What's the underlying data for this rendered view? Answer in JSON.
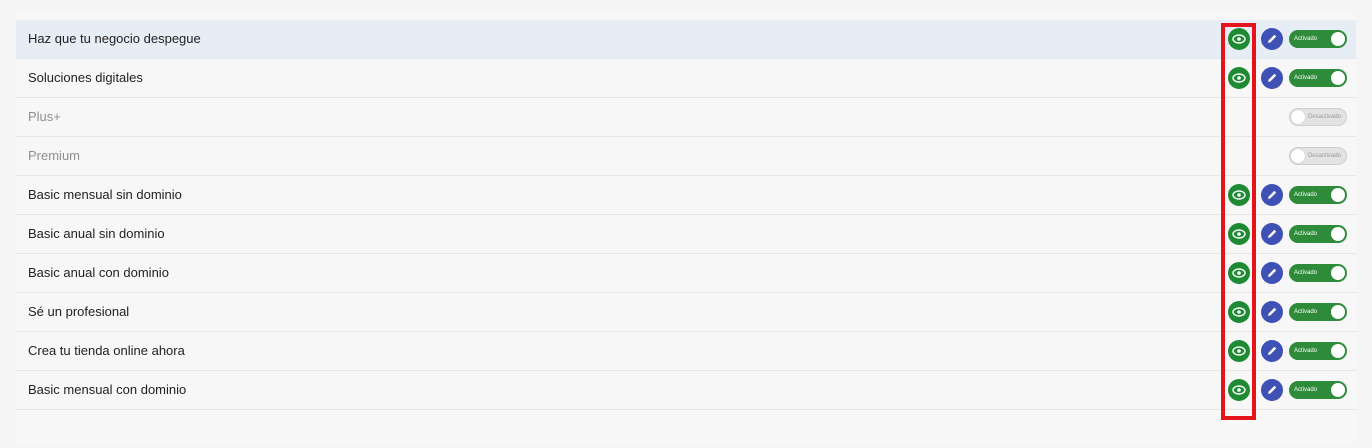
{
  "colors": {
    "eye": "#1f8a34",
    "edit": "#3f51b5",
    "toggle_on": "#2e8b3a",
    "highlight_box": "#e5141b"
  },
  "rows": [
    {
      "label": "Haz que tu negocio despegue",
      "active": true,
      "status": "Activado"
    },
    {
      "label": "Soluciones digitales",
      "active": true,
      "status": "Activado"
    },
    {
      "label": "Plus+",
      "active": false,
      "status": "Desactivado"
    },
    {
      "label": "Premium",
      "active": false,
      "status": "Desactivado"
    },
    {
      "label": "Basic mensual sin dominio",
      "active": true,
      "status": "Activado"
    },
    {
      "label": "Basic anual sin dominio",
      "active": true,
      "status": "Activado"
    },
    {
      "label": "Basic anual con dominio",
      "active": true,
      "status": "Activado"
    },
    {
      "label": "Sé un profesional",
      "active": true,
      "status": "Activado"
    },
    {
      "label": "Crea tu tienda online ahora",
      "active": true,
      "status": "Activado"
    },
    {
      "label": "Basic mensual con dominio",
      "active": true,
      "status": "Activado"
    }
  ],
  "icons": {
    "view": "eye-icon",
    "edit": "pencil-icon"
  }
}
